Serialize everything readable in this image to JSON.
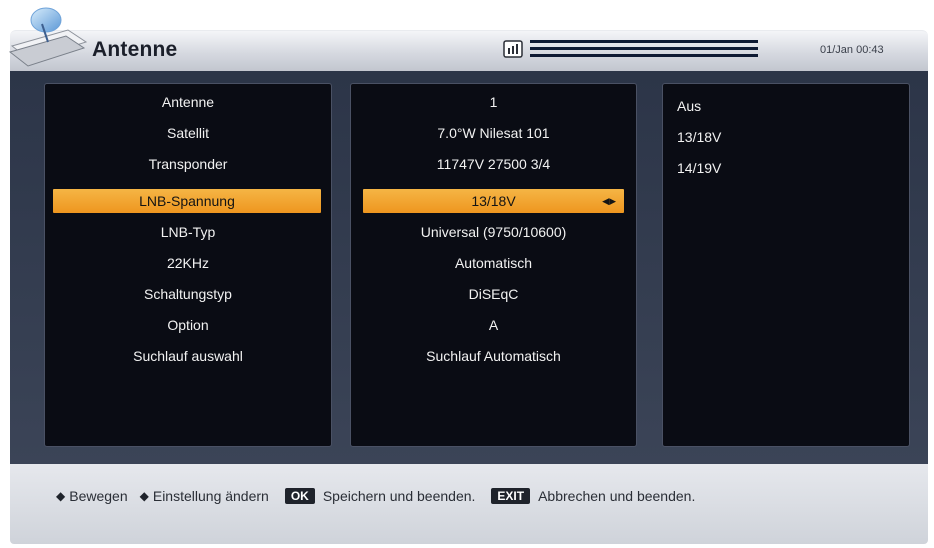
{
  "header": {
    "title": "Antenne",
    "clock": "01/Jan 00:43"
  },
  "labels": [
    "Antenne",
    "Satellit",
    "Transponder",
    "LNB-Spannung",
    "LNB-Typ",
    "22KHz",
    "Schaltungstyp",
    "Option",
    "Suchlauf auswahl"
  ],
  "values": [
    "1",
    "7.0°W Nilesat 101",
    "11747V 27500 3/4",
    "13/18V",
    "Universal (9750/10600)",
    "Automatisch",
    "DiSEqC",
    "A",
    "Suchlauf Automatisch"
  ],
  "selected_index": 3,
  "options": [
    "Aus",
    "13/18V",
    "14/19V"
  ],
  "help": {
    "move": "Bewegen",
    "change": "Einstellung ändern",
    "ok_key": "OK",
    "ok_text": "Speichern und beenden.",
    "exit_key": "EXIT",
    "exit_text": "Abbrechen und beenden."
  },
  "colors": {
    "highlight": "#f0a02a",
    "panel": "#0a0c14",
    "background": "#2c3548"
  },
  "icons": [
    "satellite-dish-logo-icon",
    "signal-icon",
    "up-down-arrows-icon",
    "left-right-arrows-icon"
  ]
}
